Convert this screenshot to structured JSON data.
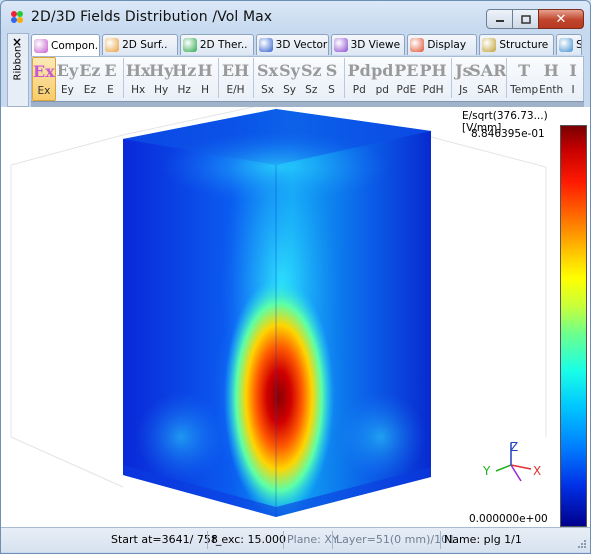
{
  "window": {
    "title": "2D/3D Fields Distribution /Vol Max",
    "buttons": [
      "minimize",
      "maximize",
      "close"
    ]
  },
  "ribbon_side": {
    "close": "×",
    "label": "Ribbon"
  },
  "tabs": [
    {
      "label": "Compon.",
      "icon": "component-icon",
      "active": true
    },
    {
      "label": "2D Surf..",
      "icon": "surface-icon"
    },
    {
      "label": "2D Ther..",
      "icon": "thermal-icon"
    },
    {
      "label": "3D Vector",
      "icon": "vector-icon"
    },
    {
      "label": "3D Viewe",
      "icon": "viewer-icon"
    },
    {
      "label": "Display",
      "icon": "display-icon"
    },
    {
      "label": "Structure",
      "icon": "structure-icon"
    },
    {
      "label": "S",
      "icon": "more-icon"
    }
  ],
  "toolbar": {
    "tools": [
      {
        "big": "Ex",
        "label": "Ex",
        "selected": true
      },
      {
        "big": "Ey",
        "label": "Ey"
      },
      {
        "big": "Ez",
        "label": "Ez"
      },
      {
        "big": "E",
        "label": "E"
      },
      {
        "big": "Hx",
        "label": "Hx"
      },
      {
        "big": "Hy",
        "label": "Hy"
      },
      {
        "big": "Hz",
        "label": "Hz"
      },
      {
        "big": "H",
        "label": "H"
      },
      {
        "big": "EH",
        "label": "E/H"
      },
      {
        "big": "Sx",
        "label": "Sx"
      },
      {
        "big": "Sy",
        "label": "Sy"
      },
      {
        "big": "Sz",
        "label": "Sz"
      },
      {
        "big": "S",
        "label": "S"
      },
      {
        "big": "Pd",
        "label": "Pd"
      },
      {
        "big": "pd",
        "label": "pd"
      },
      {
        "big": "PE",
        "label": "PdE"
      },
      {
        "big": "PH",
        "label": "PdH"
      },
      {
        "big": "Js",
        "label": "Js"
      },
      {
        "big": "SAR",
        "label": "SAR"
      },
      {
        "big": "T",
        "label": "Temp"
      },
      {
        "big": "H",
        "label": "Enth"
      },
      {
        "big": "I",
        "label": "I"
      }
    ]
  },
  "plot": {
    "colorbar_title": "E/sqrt(376.73...) [V/mm]",
    "max_value": "8.846395e-01",
    "min_value": "0.000000e+00",
    "axes": {
      "x": "X",
      "y": "Y",
      "z": "Z"
    },
    "colors": {
      "x_axis": "#e03030",
      "y_axis": "#20b020",
      "z_axis": "#2040c0"
    }
  },
  "status": {
    "start": "Start at=3641/ 758",
    "f_exc": "f_exc: 15.000",
    "plane": "Plane: XY",
    "layer": "Layer=51(0 mm)/101",
    "name": "Name: plg 1/1"
  }
}
